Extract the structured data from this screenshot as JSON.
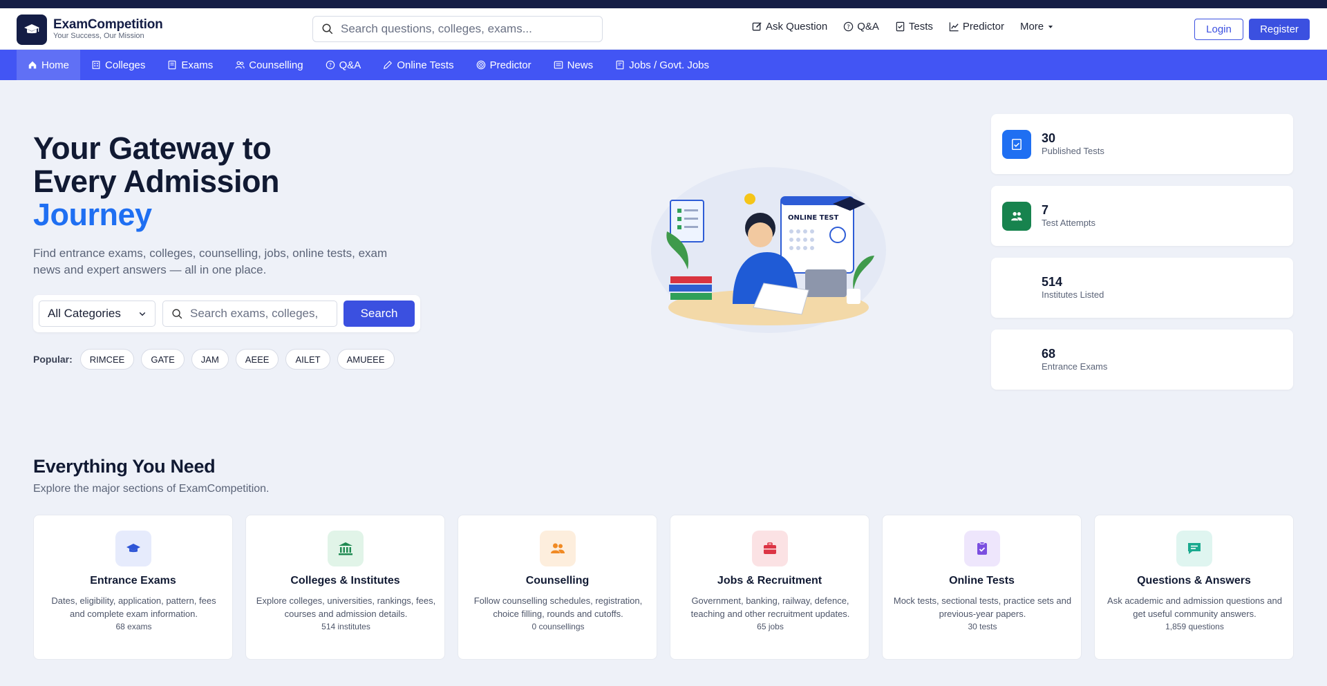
{
  "header": {
    "brand_name": "ExamCompetition",
    "brand_tagline": "Your Success, Our Mission",
    "search_placeholder": "Search questions, colleges, exams...",
    "links": [
      {
        "label": "Ask Question",
        "icon": "edit-icon"
      },
      {
        "label": "Q&A",
        "icon": "question-circle-icon"
      },
      {
        "label": "Tests",
        "icon": "checklist-icon"
      },
      {
        "label": "Predictor",
        "icon": "trend-chart-icon"
      },
      {
        "label": "More",
        "icon": "caret-down-icon"
      }
    ],
    "login_label": "Login",
    "register_label": "Register"
  },
  "main_nav": [
    {
      "label": "Home",
      "icon": "home-icon",
      "active": true
    },
    {
      "label": "Colleges",
      "icon": "building-icon"
    },
    {
      "label": "Exams",
      "icon": "book-icon"
    },
    {
      "label": "Counselling",
      "icon": "users-icon"
    },
    {
      "label": "Q&A",
      "icon": "question-circle-icon"
    },
    {
      "label": "Online Tests",
      "icon": "pencil-icon"
    },
    {
      "label": "Predictor",
      "icon": "target-icon"
    },
    {
      "label": "News",
      "icon": "newspaper-icon"
    },
    {
      "label": "Jobs / Govt. Jobs",
      "icon": "document-icon"
    }
  ],
  "hero": {
    "title_line1": "Your Gateway to",
    "title_line2": "Every Admission",
    "title_accent": "Journey",
    "description": "Find entrance exams, colleges, counselling, jobs, online tests, exam news and expert answers — all in one place.",
    "category_selected": "All Categories",
    "search_placeholder": "Search exams, colleges,",
    "search_button": "Search",
    "popular_label": "Popular:",
    "popular_tags": [
      "RIMCEE",
      "GATE",
      "JAM",
      "AEEE",
      "AILET",
      "AMUEEE"
    ]
  },
  "stats": [
    {
      "value": "30",
      "label": "Published Tests",
      "icon": "test-doc-icon",
      "color": "#1f6ff2"
    },
    {
      "value": "7",
      "label": "Test Attempts",
      "icon": "users-icon",
      "color": "#17834e"
    },
    {
      "value": "514",
      "label": "Institutes Listed",
      "icon": "",
      "color": ""
    },
    {
      "value": "68",
      "label": "Entrance Exams",
      "icon": "",
      "color": ""
    }
  ],
  "features_section": {
    "title": "Everything You Need",
    "subtitle": "Explore the major sections of ExamCompetition.",
    "cards": [
      {
        "title": "Entrance Exams",
        "description": "Dates, eligibility, application, pattern, fees and complete exam information.",
        "count": "68 exams",
        "icon": "graduation-cap-icon",
        "color": "#2f56d6",
        "bg": "#e6ebfc"
      },
      {
        "title": "Colleges & Institutes",
        "description": "Explore colleges, universities, rankings, fees, courses and admission details.",
        "count": "514 institutes",
        "icon": "bank-building-icon",
        "color": "#1f8a52",
        "bg": "#e1f4e8"
      },
      {
        "title": "Counselling",
        "description": "Follow counselling schedules, registration, choice filling, rounds and cutoffs.",
        "count": "0 counsellings",
        "icon": "users-icon",
        "color": "#f08a24",
        "bg": "#fdeedd"
      },
      {
        "title": "Jobs & Recruitment",
        "description": "Government, banking, railway, defence, teaching and other recruitment updates.",
        "count": "65 jobs",
        "icon": "briefcase-icon",
        "color": "#dc3545",
        "bg": "#fbe2e4"
      },
      {
        "title": "Online Tests",
        "description": "Mock tests, sectional tests, practice sets and previous-year papers.",
        "count": "30 tests",
        "icon": "clipboard-check-icon",
        "color": "#7b4fe0",
        "bg": "#eee6fc"
      },
      {
        "title": "Questions & Answers",
        "description": "Ask academic and admission questions and get useful community answers.",
        "count": "1,859 questions",
        "icon": "chat-icon",
        "color": "#1aaa8f",
        "bg": "#dff5f0"
      }
    ]
  }
}
